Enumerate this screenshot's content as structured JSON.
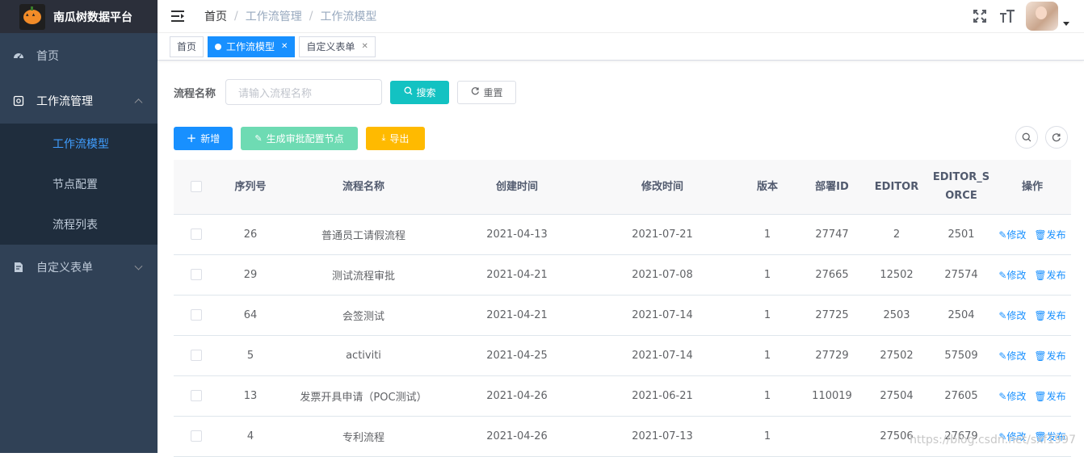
{
  "app": {
    "title": "南瓜树数据平台"
  },
  "sidebar": {
    "items": [
      {
        "label": "首页",
        "icon": "dashboard-icon"
      },
      {
        "label": "工作流管理",
        "icon": "workflow-icon",
        "expanded": true,
        "children": [
          {
            "label": "工作流模型",
            "active": true
          },
          {
            "label": "节点配置"
          },
          {
            "label": "流程列表"
          }
        ]
      },
      {
        "label": "自定义表单",
        "icon": "form-icon",
        "expanded": false
      }
    ]
  },
  "header": {
    "breadcrumb": [
      "首页",
      "工作流管理",
      "工作流模型"
    ]
  },
  "tags": [
    {
      "label": "首页"
    },
    {
      "label": "工作流模型",
      "active": true
    },
    {
      "label": "自定义表单"
    }
  ],
  "search": {
    "label": "流程名称",
    "placeholder": "请输入流程名称",
    "search_label": "搜索",
    "reset_label": "重置"
  },
  "toolbar": {
    "add_label": "新增",
    "generate_label": "生成审批配置节点",
    "export_label": "导出"
  },
  "table": {
    "headers": [
      "序列号",
      "流程名称",
      "创建时间",
      "修改时间",
      "版本",
      "部署ID",
      "EDITOR",
      "EDITOR_SORCE",
      "操作"
    ],
    "edit_label": "修改",
    "publish_label": "发布",
    "rows": [
      {
        "id": "26",
        "name": "普通员工请假流程",
        "created": "2021-04-13",
        "modified": "2021-07-21",
        "version": "1",
        "deploy_id": "27747",
        "editor": "2",
        "editor_source": "2501"
      },
      {
        "id": "29",
        "name": "测试流程审批",
        "created": "2021-04-21",
        "modified": "2021-07-08",
        "version": "1",
        "deploy_id": "27665",
        "editor": "12502",
        "editor_source": "27574"
      },
      {
        "id": "64",
        "name": "会签测试",
        "created": "2021-04-21",
        "modified": "2021-07-14",
        "version": "1",
        "deploy_id": "27725",
        "editor": "2503",
        "editor_source": "2504"
      },
      {
        "id": "5",
        "name": "activiti",
        "created": "2021-04-25",
        "modified": "2021-07-14",
        "version": "1",
        "deploy_id": "27729",
        "editor": "27502",
        "editor_source": "57509"
      },
      {
        "id": "13",
        "name": "发票开具申请（POC测试）",
        "created": "2021-04-26",
        "modified": "2021-06-21",
        "version": "1",
        "deploy_id": "110019",
        "editor": "27504",
        "editor_source": "27605"
      },
      {
        "id": "4",
        "name": "专利流程",
        "created": "2021-04-26",
        "modified": "2021-07-13",
        "version": "1",
        "deploy_id": "",
        "editor": "27506",
        "editor_source": "27679"
      }
    ]
  },
  "watermark": "https://blog.csdn.net/sxf1997"
}
